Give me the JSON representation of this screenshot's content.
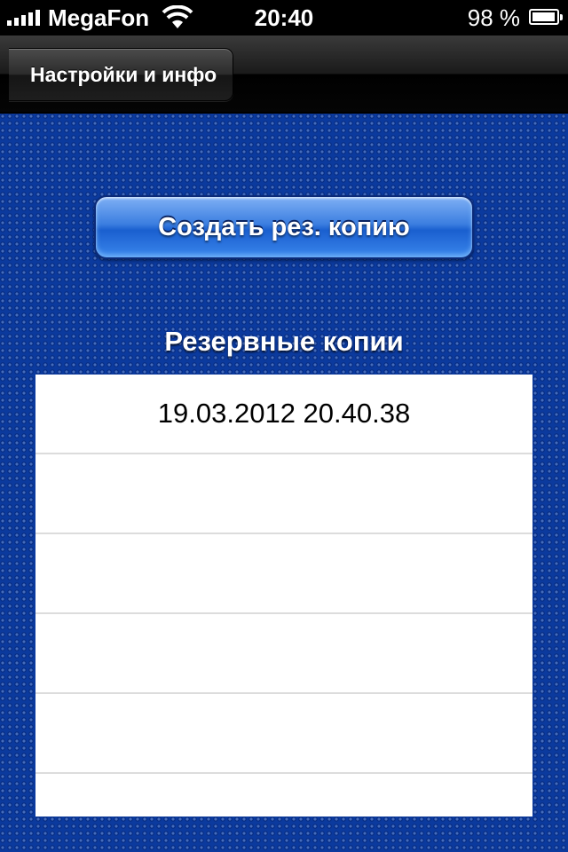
{
  "status_bar": {
    "carrier": "MegaFon",
    "time": "20:40",
    "battery_percent": "98 %",
    "battery_level": 0.98,
    "signal_bars": 5,
    "wifi_icon": "wifi-icon",
    "battery_icon": "battery-icon"
  },
  "nav_bar": {
    "back_label": "Настройки и инфо"
  },
  "actions": {
    "create_backup_label": "Создать рез. копию"
  },
  "backups": {
    "title": "Резервные копии",
    "items": [
      {
        "label": "19.03.2012 20.40.38"
      },
      {
        "label": ""
      },
      {
        "label": ""
      },
      {
        "label": ""
      },
      {
        "label": ""
      },
      {
        "label": ""
      }
    ]
  },
  "colors": {
    "background": "#0b3a9e",
    "button_blue": "#3b7ee0",
    "nav_bar": "#1a1a1a"
  }
}
